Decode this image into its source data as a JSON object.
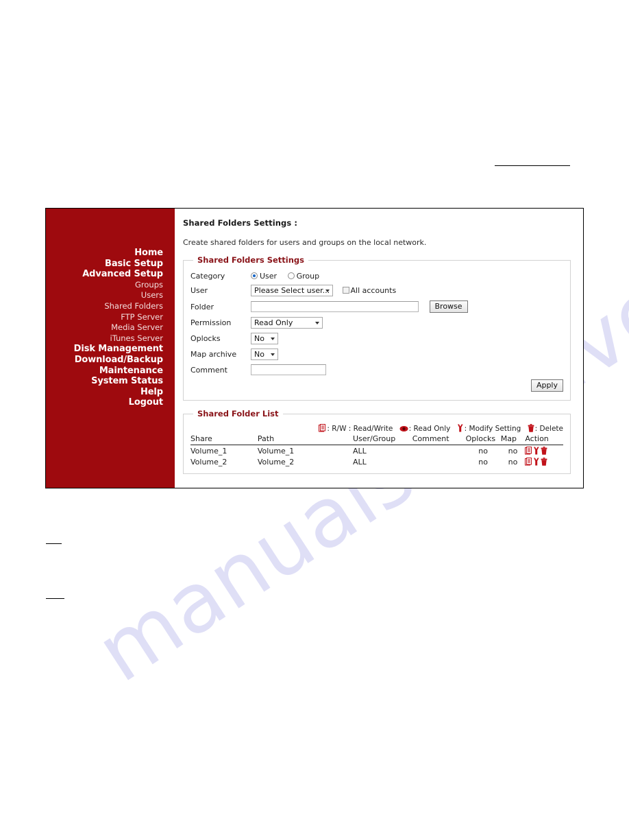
{
  "watermark": {
    "text": "manualsarchive.com"
  },
  "sidebar": {
    "items": [
      {
        "label": "Home",
        "level": "top"
      },
      {
        "label": "Basic Setup",
        "level": "top"
      },
      {
        "label": "Advanced Setup",
        "level": "top"
      },
      {
        "label": "Groups",
        "level": "sub"
      },
      {
        "label": "Users",
        "level": "sub"
      },
      {
        "label": "Shared Folders",
        "level": "sub"
      },
      {
        "label": "FTP Server",
        "level": "sub"
      },
      {
        "label": "Media Server",
        "level": "sub"
      },
      {
        "label": "iTunes Server",
        "level": "sub"
      },
      {
        "label": "Disk Management",
        "level": "top"
      },
      {
        "label": "Download/Backup",
        "level": "top"
      },
      {
        "label": "Maintenance",
        "level": "top"
      },
      {
        "label": "System Status",
        "level": "top"
      },
      {
        "label": "Help",
        "level": "top"
      },
      {
        "label": "Logout",
        "level": "top"
      }
    ]
  },
  "content": {
    "page_title": "Shared Folders Settings :",
    "page_description": "Create shared folders for users and groups on the local network."
  },
  "settings_panel": {
    "legend": "Shared Folders Settings",
    "labels": {
      "category": "Category",
      "user": "User",
      "folder": "Folder",
      "permission": "Permission",
      "oplocks": "Oplocks",
      "map_archive": "Map archive",
      "comment": "Comment"
    },
    "category": {
      "user_label": "User",
      "group_label": "Group",
      "selected": "User"
    },
    "user_select": {
      "value": "Please Select user..."
    },
    "all_accounts": {
      "label": "All accounts",
      "checked": false
    },
    "folder_input": {
      "value": "",
      "browse_label": "Browse"
    },
    "permission_select": {
      "value": "Read Only"
    },
    "oplocks_select": {
      "value": "No"
    },
    "map_archive_select": {
      "value": "No"
    },
    "comment_input": {
      "value": ""
    },
    "apply_label": "Apply"
  },
  "list_panel": {
    "legend": "Shared Folder List",
    "icon_legend": [
      {
        "icon": "document-icon",
        "text": ": R/W : Read/Write"
      },
      {
        "icon": "eye-icon",
        "text": ": Read Only"
      },
      {
        "icon": "wrench-icon",
        "text": ": Modify Setting"
      },
      {
        "icon": "trash-icon",
        "text": ": Delete"
      }
    ],
    "columns": [
      "Share",
      "Path",
      "User/Group",
      "Comment",
      "Oplocks",
      "Map",
      "Action"
    ],
    "rows": [
      {
        "share": "Volume_1",
        "path": "Volume_1",
        "user_group": "ALL",
        "comment": "",
        "oplocks": "no",
        "map": "no"
      },
      {
        "share": "Volume_2",
        "path": "Volume_2",
        "user_group": "ALL",
        "comment": "",
        "oplocks": "no",
        "map": "no"
      }
    ]
  },
  "colors": {
    "sidebar_bg": "#9e0a0e",
    "legend_text": "#8a1419",
    "icon_red": "#c1121a",
    "radio_accent": "#1766c6",
    "watermark": "#ccccf2"
  }
}
